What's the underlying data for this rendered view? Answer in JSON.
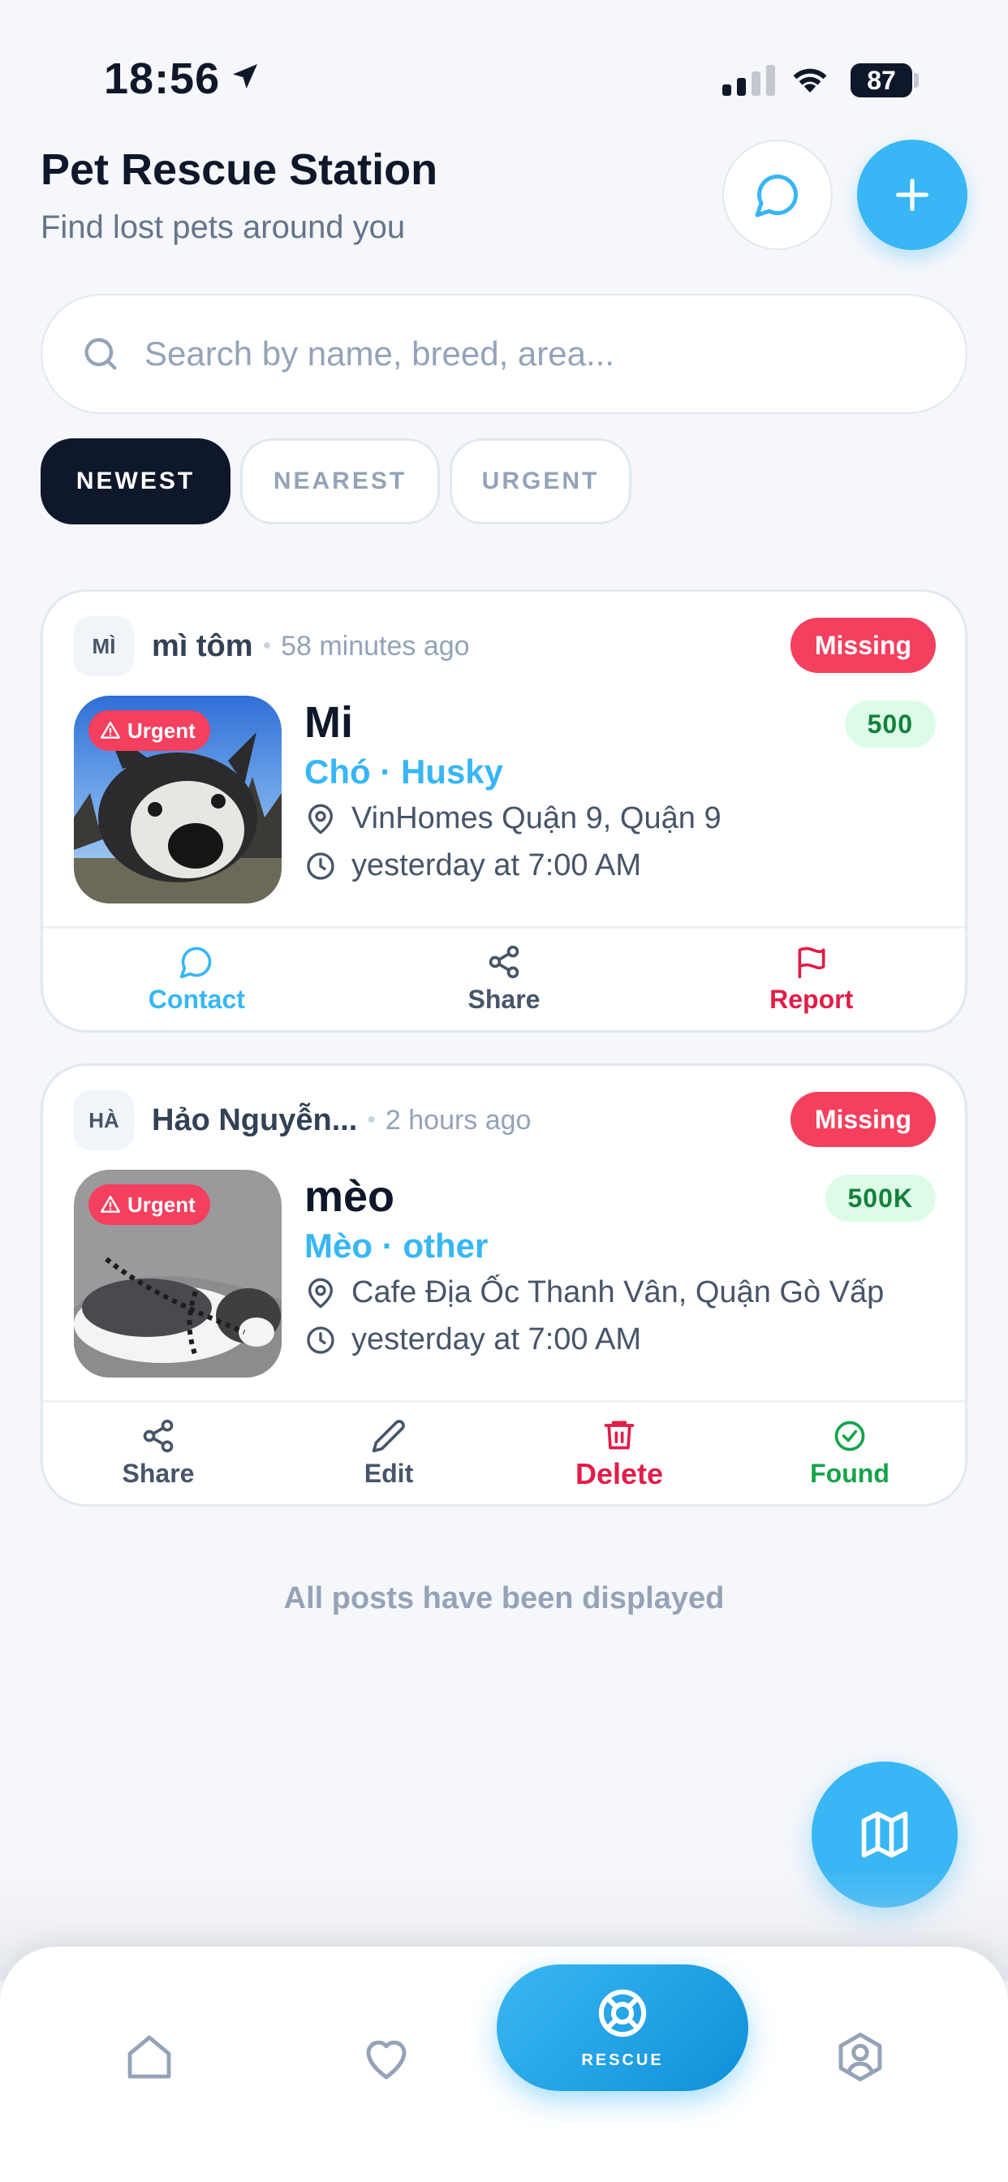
{
  "status_bar": {
    "time": "18:56",
    "battery": "87"
  },
  "header": {
    "title": "Pet Rescue Station",
    "subtitle": "Find lost pets around you"
  },
  "search": {
    "placeholder": "Search by name, breed, area..."
  },
  "filters": [
    {
      "label": "NEWEST",
      "active": true
    },
    {
      "label": "NEAREST",
      "active": false
    },
    {
      "label": "URGENT",
      "active": false
    }
  ],
  "posts": [
    {
      "avatar": "MÌ",
      "author": "mì tôm",
      "time_ago": "58 minutes ago",
      "status": "Missing",
      "urgent_label": "Urgent",
      "pet_name": "Mi",
      "species_breed": "Chó · Husky",
      "location": "VinHomes Quận 9, Quận 9",
      "lost_time": "yesterday at 7:00 AM",
      "reward": "500",
      "actions": [
        "Contact",
        "Share",
        "Report"
      ]
    },
    {
      "avatar": "HÀ",
      "author": "Hảo Nguyễn...",
      "time_ago": "2 hours ago",
      "status": "Missing",
      "urgent_label": "Urgent",
      "pet_name": "mèo",
      "species_breed": "Mèo · other",
      "location": "Cafe Địa Ốc Thanh Vân, Quận Gò Vấp",
      "lost_time": "yesterday at 7:00 AM",
      "reward": "500K",
      "actions": [
        "Share",
        "Edit",
        "Delete",
        "Found"
      ]
    }
  ],
  "end_message": "All posts have been displayed",
  "bottom_nav": {
    "center_label": "RESCUE"
  },
  "colors": {
    "accent": "#38b6f5",
    "danger": "#f43f5e",
    "success": "#16a34a",
    "dark": "#0f172a"
  }
}
